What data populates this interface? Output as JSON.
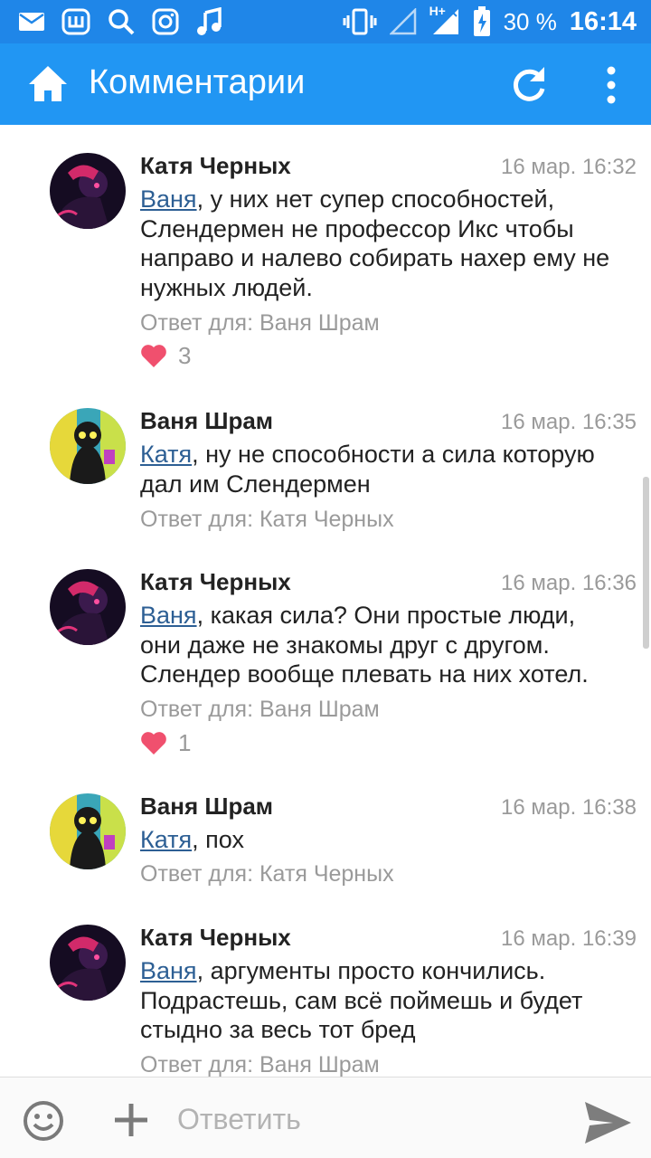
{
  "status_bar": {
    "battery": "30 %",
    "time": "16:14",
    "network": "H+",
    "icons": [
      "mail-icon",
      "app-w-icon",
      "search-icon",
      "instagram-icon",
      "music-icon",
      "vibrate-icon",
      "signal-icon",
      "battery-icon"
    ]
  },
  "app_bar": {
    "title": "Комментарии",
    "icons": [
      "home-icon",
      "refresh-icon",
      "more-vert-icon"
    ]
  },
  "comments": [
    {
      "author": "Катя Черных",
      "date": "16 мар. 16:32",
      "mention": "Ваня",
      "text_lines": [
        ", у них нет супер способностей,",
        "Слендермен не профессор Икс чтобы",
        "направо и налево собирать нахер ему не",
        "нужных людей."
      ],
      "reply_to": "Ответ для: Ваня Шрам",
      "likes": "3"
    },
    {
      "author": "Ваня Шрам",
      "date": "16 мар. 16:35",
      "mention": "Катя",
      "text_lines": [
        ", ну не способности а сила которую",
        "дал им Слендермен"
      ],
      "reply_to": "Ответ для: Катя Черных"
    },
    {
      "author": "Катя Черных",
      "date": "16 мар. 16:36",
      "mention": "Ваня",
      "text_lines": [
        ", какая сила? Они простые люди,",
        "они даже не знакомы друг с другом.",
        "Слендер вообще плевать на них хотел."
      ],
      "reply_to": "Ответ для: Ваня Шрам",
      "likes": "1"
    },
    {
      "author": "Ваня Шрам",
      "date": "16 мар. 16:38",
      "mention": "Катя",
      "text_lines": [
        ", пох"
      ],
      "reply_to": "Ответ для: Катя Черных"
    },
    {
      "author": "Катя Черных",
      "date": "16 мар. 16:39",
      "mention": "Ваня",
      "text_lines": [
        ", аргументы просто кончились.",
        "Подрастешь, сам всё поймешь и будет",
        "стыдно за весь тот бред"
      ],
      "reply_to": "Ответ для: Ваня Шрам"
    }
  ],
  "composer": {
    "placeholder": "Ответить",
    "icons": [
      "emoji-icon",
      "plus-icon",
      "send-icon"
    ]
  },
  "colors": {
    "status_bar": "#1f86e8",
    "app_bar": "#2196f3",
    "mention": "#2d5f94",
    "like_heart": "#f0506e",
    "meta_text": "#9a9a9a"
  }
}
